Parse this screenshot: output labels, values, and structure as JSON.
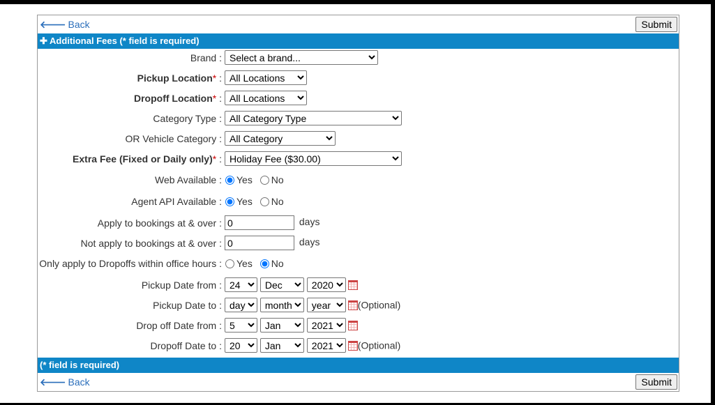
{
  "nav": {
    "back_label": "Back",
    "submit_label": "Submit"
  },
  "header": {
    "icon": "plus-icon",
    "title": "Additional Fees (* field is required)"
  },
  "footer": {
    "note": "(* field is required)"
  },
  "colors": {
    "bar": "#0f86c7",
    "link": "#2a6ebb",
    "required": "#cc0000"
  },
  "required_mark": "*",
  "form": {
    "brand": {
      "label": "Brand :",
      "value": "Select a brand..."
    },
    "pickup_location": {
      "label": "Pickup Location",
      "suffix": " :",
      "value": "All Locations"
    },
    "dropoff_location": {
      "label": "Dropoff Location",
      "suffix": " :",
      "value": "All Locations"
    },
    "category_type": {
      "label": "Category Type :",
      "value": "All Category Type"
    },
    "vehicle_category": {
      "label": "OR Vehicle Category :",
      "value": "All Category"
    },
    "extra_fee": {
      "label": "Extra Fee (Fixed or Daily only)",
      "suffix": " :",
      "value": "Holiday Fee ($30.00)"
    },
    "web_available": {
      "label": "Web Available :",
      "yes": "Yes",
      "no": "No",
      "selected": "Yes"
    },
    "agent_api": {
      "label": "Agent API Available :",
      "yes": "Yes",
      "no": "No",
      "selected": "Yes"
    },
    "apply_days": {
      "label": "Apply to bookings at & over :",
      "value": "0",
      "unit": "days"
    },
    "not_apply_days": {
      "label": "Not apply to bookings at & over :",
      "value": "0",
      "unit": "days"
    },
    "office_hours": {
      "label": "Only apply to Dropoffs within office hours :",
      "yes": "Yes",
      "no": "No",
      "selected": "No"
    },
    "pickup_from": {
      "label": "Pickup Date from :",
      "day": "24",
      "month": "Dec",
      "year": "2020",
      "optional": ""
    },
    "pickup_to": {
      "label": "Pickup Date to :",
      "day": "day",
      "month": "month",
      "year": "year",
      "optional": "(Optional)"
    },
    "dropoff_from": {
      "label": "Drop off Date from :",
      "day": "5",
      "month": "Jan",
      "year": "2021",
      "optional": ""
    },
    "dropoff_to": {
      "label": "Dropoff Date to :",
      "day": "20",
      "month": "Jan",
      "year": "2021",
      "optional": "(Optional)"
    }
  }
}
